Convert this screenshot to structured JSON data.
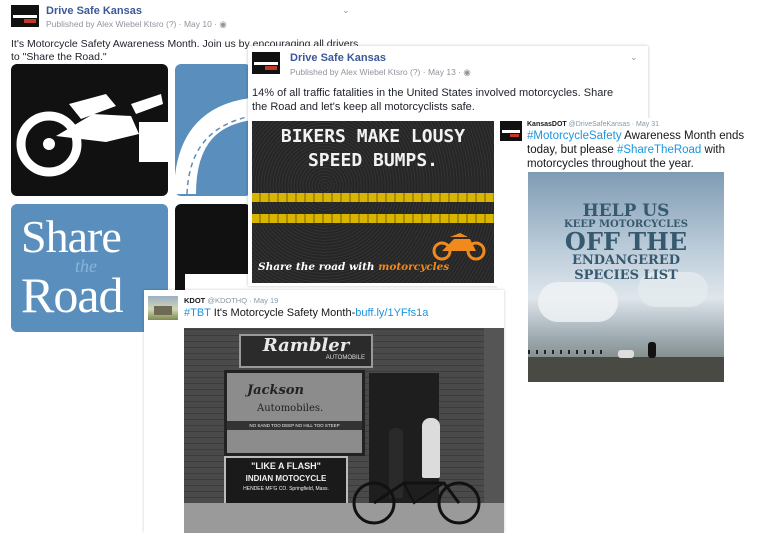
{
  "post1": {
    "page_name": "Drive Safe Kansas",
    "meta": "Published by Alex Wiebel Ktsro (?) · May 10 · ",
    "text_line1": "It's Motorcycle Safety Awareness Month. Join us by encouraging all drivers",
    "text_line2": "to \"Share the Road.\"",
    "sign_word1": "Share",
    "sign_word2": "the",
    "sign_word3": "Road"
  },
  "post2": {
    "page_name": "Drive Safe Kansas",
    "meta": "Published by Alex Wiebel Ktsro (?) · May 13 · ",
    "text_line1": "14% of all traffic fatalities in the United States involved motorcycles. Share",
    "text_line2": "the Road and let's keep all motorcyclists safe.",
    "image_headline1": "BIKERS MAKE LOUSY",
    "image_headline2": "SPEED BUMPS.",
    "image_tagline_prefix": "Share the road with ",
    "image_tagline_highlight": "motorcycles"
  },
  "tweet1": {
    "handle_name": "KansasDOT",
    "handle": "@DriveSafeKansas · May 31",
    "hashtag1": "#MotorcycleSafety",
    "text_part1": " Awareness Month ends",
    "text_part2": "today, but please ",
    "hashtag2": "#ShareTheRoad",
    "text_part3": " with",
    "text_part4": "motorcycles throughout the year.",
    "poster_line1": "HELP US",
    "poster_line2": "KEEP MOTORCYCLES",
    "poster_line3": "OFF THE",
    "poster_line4": "ENDANGERED",
    "poster_line5": "SPECIES LIST"
  },
  "tweet2": {
    "handle_name": "KDOT",
    "handle": "@KDOTHQ · May 19",
    "hashtag": "#TBT",
    "text": " It's Motorcycle Safety Month-",
    "link": "buff.ly/1YFfs1a",
    "photo_sign_top": "Rambler",
    "photo_sign_sub": "AUTOMOBILE",
    "photo_window1": "Jackson",
    "photo_window2": "Automobiles.",
    "photo_window_strip": "NO SAND TOO DEEP NO HILL TOO STEEP",
    "photo_board1": "\"LIKE A FLASH\"",
    "photo_board2": "INDIAN MOTOCYCLE",
    "photo_board3": "HENDEE MF'G CO. Springfield, Mass."
  },
  "colors": {
    "fb_link": "#3b5998",
    "twitter_link": "#1b95e0",
    "sign_blue": "#5a8fbd",
    "stripe_yellow": "#d9b400",
    "moto_orange": "#f08a1c"
  }
}
